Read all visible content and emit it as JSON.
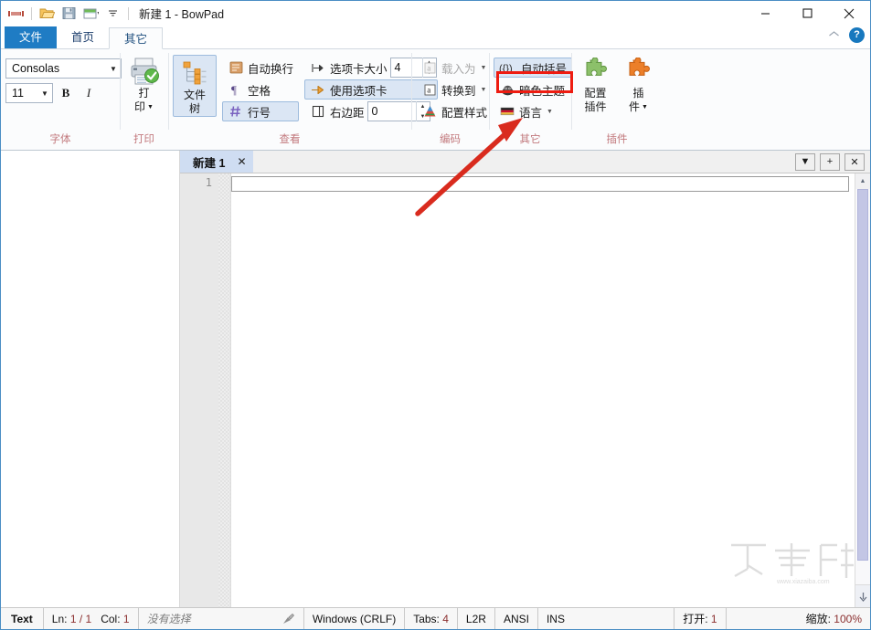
{
  "window": {
    "title": "新建 1 - BowPad",
    "quick_access": [
      {
        "name": "bowpad-logo-icon",
        "label": ""
      },
      {
        "name": "open-file-icon",
        "label": ""
      },
      {
        "name": "save-icon",
        "label": ""
      },
      {
        "name": "new-window-icon",
        "label": ""
      },
      {
        "name": "customize-qat-icon",
        "label": ""
      }
    ],
    "controls": {
      "minimize": "—",
      "maximize": "☐",
      "close": "✕"
    }
  },
  "ribbon": {
    "tabs": [
      {
        "id": "file",
        "label": "文件",
        "state": "file"
      },
      {
        "id": "home",
        "label": "首页",
        "state": "normal"
      },
      {
        "id": "other",
        "label": "其它",
        "state": "active"
      }
    ],
    "collapse_icon": "chevron-up-icon",
    "help_label": "?",
    "groups": [
      {
        "id": "font",
        "label": "字体",
        "font_name": "Consolas",
        "font_size": "11",
        "bold_label": "B",
        "italic_label": "I"
      },
      {
        "id": "print",
        "label": "打印",
        "print_label": "打 印",
        "print_line1": "打",
        "print_line2": "印"
      },
      {
        "id": "view",
        "label": "查看",
        "file_tree_line1": "文件",
        "file_tree_line2": "树",
        "auto_wrap": "自动换行",
        "whitespace": "空格",
        "line_numbers": "行号",
        "tab_size_label": "选项卡大小",
        "tab_size_value": "4",
        "use_tabs": "使用选项卡",
        "right_margin_label": "右边距",
        "right_margin_value": "0"
      },
      {
        "id": "encoding",
        "label": "编码",
        "load_as": "载入为",
        "convert_to": "转换到",
        "config_style": "配置样式"
      },
      {
        "id": "other",
        "label": "其它",
        "auto_brackets": "自动括号",
        "dark_theme": "暗色主题",
        "language": "语言"
      },
      {
        "id": "plugins",
        "label": "插件",
        "config_plugins_line1": "配置",
        "config_plugins_line2": "插件",
        "plugins_line1": "插",
        "plugins_line2": "件"
      }
    ]
  },
  "editor": {
    "document_tab": {
      "label": "新建 1",
      "close_label": "✕"
    },
    "tab_buttons": [
      {
        "name": "tab-list-dropdown",
        "label": "▼"
      },
      {
        "name": "new-tab-button",
        "label": "+"
      },
      {
        "name": "close-tab-button",
        "label": "✕"
      }
    ],
    "line_numbers": [
      "1"
    ],
    "content": ""
  },
  "statusbar": {
    "doc_type": "Text",
    "line_label": "Ln:",
    "line_value": "1 / 1",
    "col_label": "Col:",
    "col_value": "1",
    "selection": "没有选择",
    "macro_icon": "macro-record-icon",
    "eol": "Windows (CRLF)",
    "tabs_label": "Tabs:",
    "tabs_value": "4",
    "direction": "L2R",
    "encoding": "ANSI",
    "insert_mode": "INS",
    "open_label": "打开:",
    "open_value": "1",
    "zoom_label": "缩放:",
    "zoom_value": "100%"
  },
  "annotation": {
    "highlight_target": "暗色主题",
    "highlight_color": "#ee1c11",
    "arrow_color": "#d92b1e"
  },
  "watermark": {
    "text": "下载吧",
    "url": "www.xiazaiba.com"
  },
  "colors": {
    "accent_blue": "#1f7cc4",
    "tab_active_bg": "#cfddf2",
    "group_label": "#c2797d",
    "selected_button": "#dbe6f4",
    "status_num": "#8b2f2f"
  }
}
